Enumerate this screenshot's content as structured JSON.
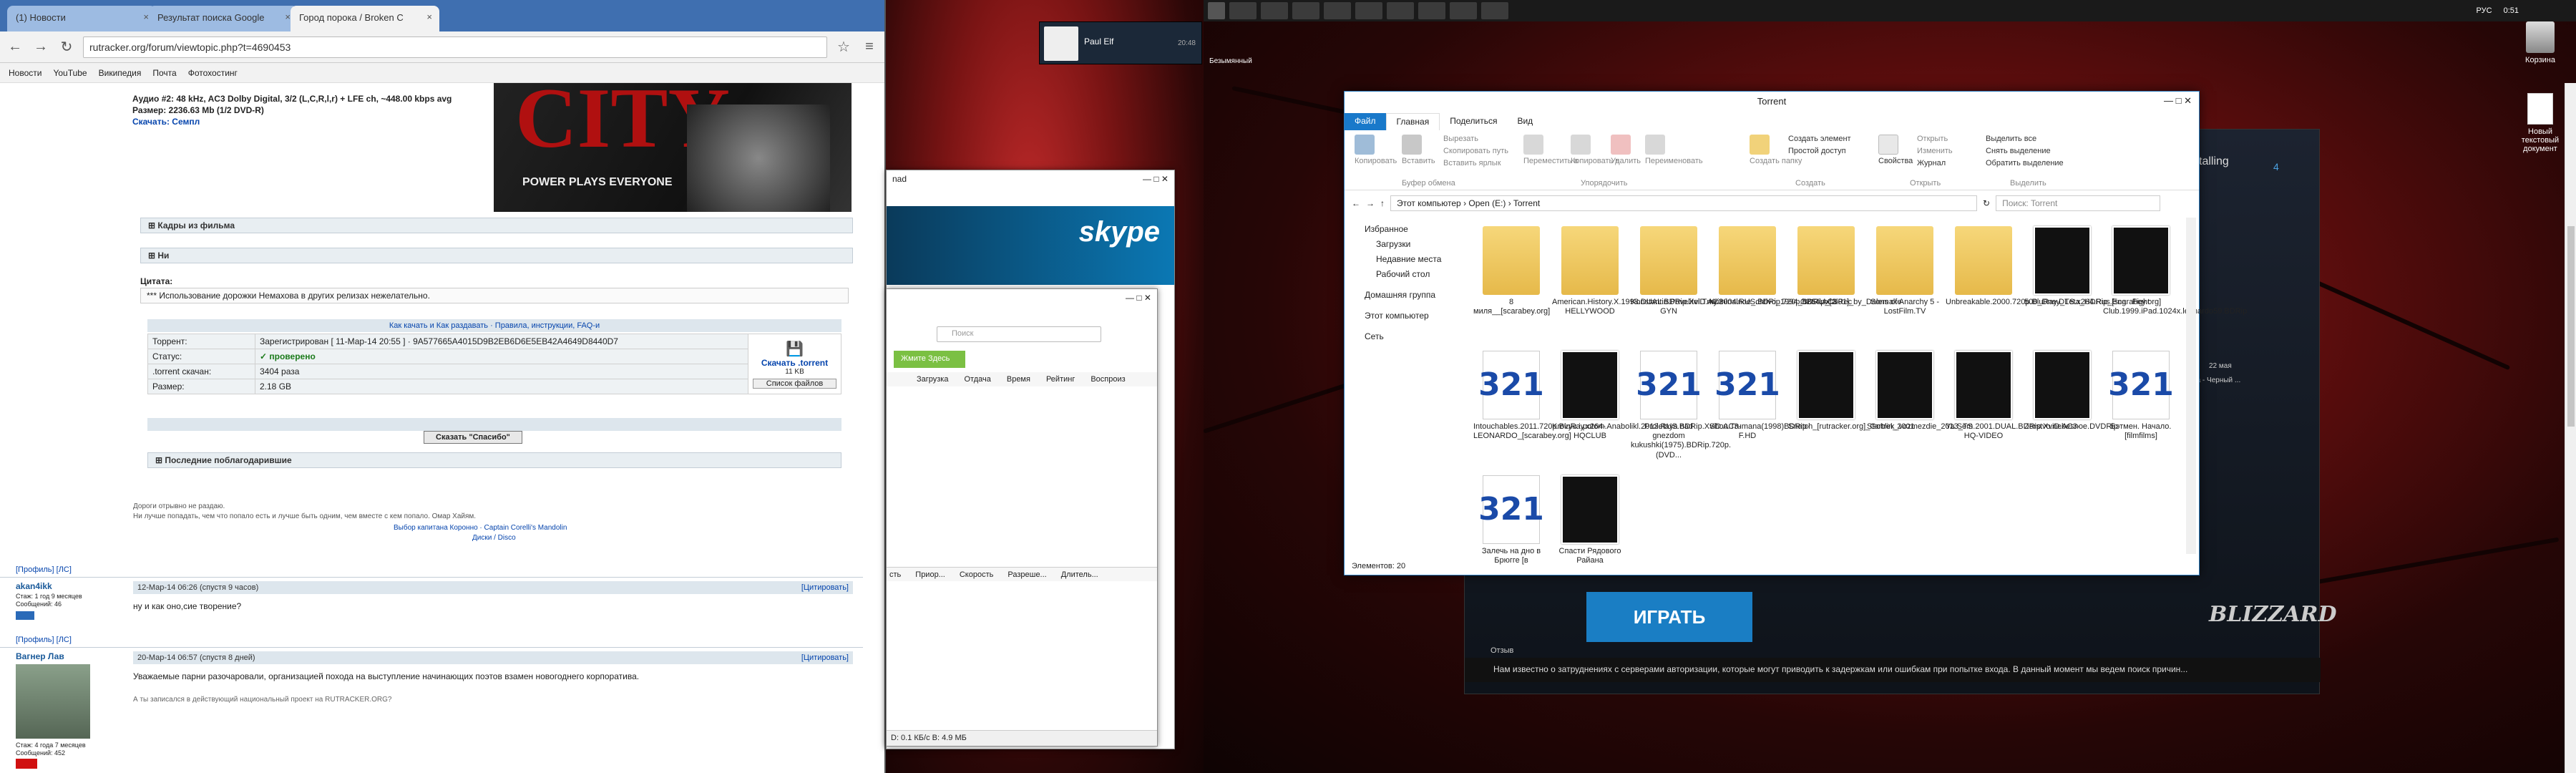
{
  "chrome": {
    "tabs": [
      "(1) Новости",
      "Результат поиска Google",
      "Город порока / Broken C"
    ],
    "url": "rutracker.org/forum/viewtopic.php?t=4690453",
    "bookmarks": [
      "Новости",
      "YouTube",
      "Википедия",
      "Почта",
      "Фотохостинг"
    ]
  },
  "forum": {
    "audio": "Аудио #2: 48 kHz, AC3 Dolby Digital, 3/2 (L,C,R,l,r) + LFE ch, ~448.00 kbps avg",
    "size": "Размер: 2236.63 Mb (1/2 DVD-R)",
    "download": "Скачать: Семпл",
    "movie_brand": "CITY",
    "movie_tagline": "POWER PLAYS EVERYONE",
    "spoiler1": "Кадры из фильма",
    "spoiler2": "Ни",
    "quote_label": "Цитата:",
    "quote": "*** Использование дорожки Немахова в других релизах нежелательно.",
    "howto": "Как качать и Как раздавать · Правила, инструкции, FAQ-и",
    "rows": [
      {
        "k": "Торрент:",
        "v": "Зарегистрирован  [ 11-Мар-14 20:55 ]  · 9A577665A4015D9B2EB6D6E5EB42A4649D8440D7"
      },
      {
        "k": "Статус:",
        "v": "✓ проверено"
      },
      {
        "k": ".torrent скачан:",
        "v": "3404 раза"
      },
      {
        "k": "Размер:",
        "v": "2.18 GB"
      }
    ],
    "dl_label": "Скачать .torrent",
    "dl_size": "11 KB",
    "files_btn": "Список файлов",
    "thanks": "Сказать \"Спасибо\"",
    "last_thanked": "Последние поблагодарившие",
    "sig1": "Дороги отрывно не раздаю.",
    "sig2": "Ни лучше попадать, чем что попало есть и лучше быть одним, чем вместе с кем попало. Омар Хайям.",
    "sig3": "Выбор капитана Коронно · Captain Corelli's Mandolin",
    "sig4": "Диски / Disco",
    "profile": "[Профиль]   [ЛС]",
    "posts": [
      {
        "user": "akan4ikk",
        "meta": "Стаж: 1 год 9 месяцев\nСообщений: 46",
        "date": "12-Мар-14 06:26  (спустя 9 часов)",
        "text": "ну и как оно,сие творение?"
      },
      {
        "user": "Вагнер Лав",
        "meta": "Стаж: 4 года 7 месяцев\nСообщений: 452",
        "date": "20-Мар-14 06:57  (спустя 8 дней)",
        "text": "Уважаемые парни разочаровали, организацией похода на выступление начинающих поэтов взамен новогоднего корпоратива.",
        "text2": "А ты записался в действующий национальный проект на RUTRACKER.ORG?"
      }
    ],
    "quote_btn": "[Цитировать]"
  },
  "steam": {
    "user": "Paul Elf",
    "time": "20:48"
  },
  "skype": {
    "brand": "skype",
    "nad": "nad"
  },
  "utorrent": {
    "search": "Поиск",
    "green_btn": "Жмите Здесь",
    "cols": [
      "Загрузка",
      "Отдача",
      "Время",
      "Рейтинг",
      "Воспроиз"
    ],
    "bottom_cols": [
      "сть",
      "Приор...",
      "Скорость",
      "Разреше...",
      "Длитель..."
    ],
    "status": "D: 0.1 КБ/с В: 4.9 МБ"
  },
  "explorer": {
    "title": "Torrent",
    "tabs": [
      "Файл",
      "Главная",
      "Поделиться",
      "Вид"
    ],
    "ribbon": [
      "Копировать",
      "Вставить",
      "Вырезать",
      "Скопировать путь",
      "Вставить ярлык",
      "Переместить в",
      "Копировать в",
      "Удалить",
      "Переименовать",
      "Создать папку",
      "Создать элемент",
      "Простой доступ",
      "Свойства",
      "Открыть",
      "Изменить",
      "Журнал",
      "Выделить все",
      "Снять выделение",
      "Обратить выделение"
    ],
    "groups": [
      "Буфер обмена",
      "Упорядочить",
      "Создать",
      "Открыть",
      "Выделить"
    ],
    "path": "Этот компьютер › Open (E:) › Torrent",
    "search": "Поиск: Torrent",
    "nav": [
      "Избранное",
      "Загрузки",
      "Недавние места",
      "Рабочий стол",
      "Домашняя группа",
      "Этот компьютер",
      "Сеть"
    ],
    "status": "Элементов: 20",
    "files": [
      {
        "n": "8 миля__[scarabey.org]",
        "t": "folder"
      },
      {
        "n": "American.History.X.1998.DUAL.BDRip.XviD.AC3-HELLYWOOD",
        "t": "folder"
      },
      {
        "n": "Konstantin.Povelitel.Tmy.2004.RUS.BDRip.720p.h264.AC3-GYN",
        "t": "folder"
      },
      {
        "n": "Kriminalnoe_chtivo_1994_BDRip_[2.91]_by_Dalemake",
        "t": "folder"
      },
      {
        "n": "OBS LocalRec",
        "t": "folder"
      },
      {
        "n": "Sons of Anarchy 5 - LostFilm.TV",
        "t": "folder"
      },
      {
        "n": "Unbreakable.2000.720p.BluRay.DTS.x264.Rus.Eng",
        "t": "folder"
      },
      {
        "n": "500_Dney_Leta_HDRip_[scarabey.org]",
        "t": "thumb"
      },
      {
        "n": "Fight Club.1999.iPad.1024x.leonardo59.BDRip",
        "t": "thumb"
      },
      {
        "n": "Intouchables.2011.720p.BluRay.x264-LEONARDO_[scarabey.org]",
        "t": "mpc"
      },
      {
        "n": "Krovyu.i.potom.Anabolikl.2013.RUS.BDRip.XviD.AC3-HQCLUB",
        "t": "thumb"
      },
      {
        "n": "Proletaya nad gnezdom kukushki(1975).BDRip.720p.(DVD...",
        "t": "mpc"
      },
      {
        "n": "Shou.Trumana(1998)BDRip-F.HD",
        "t": "mpc"
      },
      {
        "n": "Snatch_[rutracker.org]_Goblin_2001",
        "t": "thumb"
      },
      {
        "n": "Startrek_vozmezdie_2013_TS",
        "t": "thumb"
      },
      {
        "n": "Ya.Sem.2001.DUAL.BDRip.XviD.AC3-HQ-VIDEO",
        "t": "thumb"
      },
      {
        "n": "Zerstvo.nebesnoe.DVDRip",
        "t": "thumb"
      },
      {
        "n": "Бэтмен. Начало.[filmfilms]",
        "t": "mpc"
      },
      {
        "n": "Залечь на дно в Брюгге [в",
        "t": "mpc"
      },
      {
        "n": "Спасти Рядового Райана",
        "t": "thumb"
      }
    ]
  },
  "battlenet": {
    "play": "ИГРАТЬ",
    "warning": "Нам известно о затруднениях с серверами авторизации, которые могут приводить к задержкам или ошибкам при попытке входа. В данный момент мы ведем поиск причин...",
    "brand": "BLIZZARD",
    "installing": "talling",
    "count": "4",
    "news_date": "22 мая",
    "news_text": "мерка - Черный ...",
    "label": "Отзыв"
  },
  "desktop": {
    "icon1": "Корзина",
    "icon2": "Новый текстовый документ",
    "label_left": "Безымянный"
  },
  "taskbar": {
    "time": "0:51",
    "lang": "РУС"
  }
}
